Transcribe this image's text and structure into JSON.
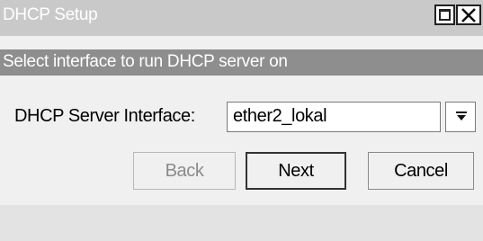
{
  "window": {
    "title": "DHCP Setup"
  },
  "section": {
    "header": "Select interface to run DHCP server on"
  },
  "form": {
    "interface_label": "DHCP Server Interface:",
    "interface_value": "ether2_lokal"
  },
  "buttons": {
    "back": "Back",
    "next": "Next",
    "cancel": "Cancel"
  },
  "icons": {
    "restore": "restore-icon",
    "close": "close-icon",
    "dropdown": "dropdown-arrow-icon"
  },
  "colors": {
    "titlebar": "#c9c9c9",
    "section_header": "#8e8e8e",
    "background": "#f0f0f0"
  }
}
